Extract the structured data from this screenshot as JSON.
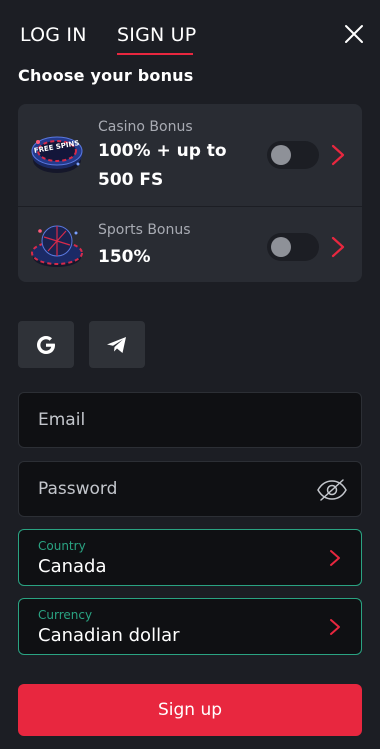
{
  "tabs": {
    "login": "LOG IN",
    "signup": "SIGN UP",
    "active": "signup"
  },
  "section_title": "Choose your bonus",
  "bonuses": [
    {
      "subtitle": "Casino Bonus",
      "title": "100% + up to 500 FS",
      "enabled": false,
      "chip_text": "FREE SPINS"
    },
    {
      "subtitle": "Sports Bonus",
      "title": "150%",
      "enabled": false
    }
  ],
  "social": [
    {
      "name": "google-icon"
    },
    {
      "name": "telegram-icon"
    }
  ],
  "form": {
    "email_placeholder": "Email",
    "password_placeholder": "Password",
    "country_label": "Country",
    "country_value": "Canada",
    "currency_label": "Currency",
    "currency_value": "Canadian dollar"
  },
  "submit_label": "Sign up",
  "colors": {
    "background": "#1c1e24",
    "card": "#292c33",
    "accent": "#e8273f",
    "select_border": "#2aa382"
  }
}
